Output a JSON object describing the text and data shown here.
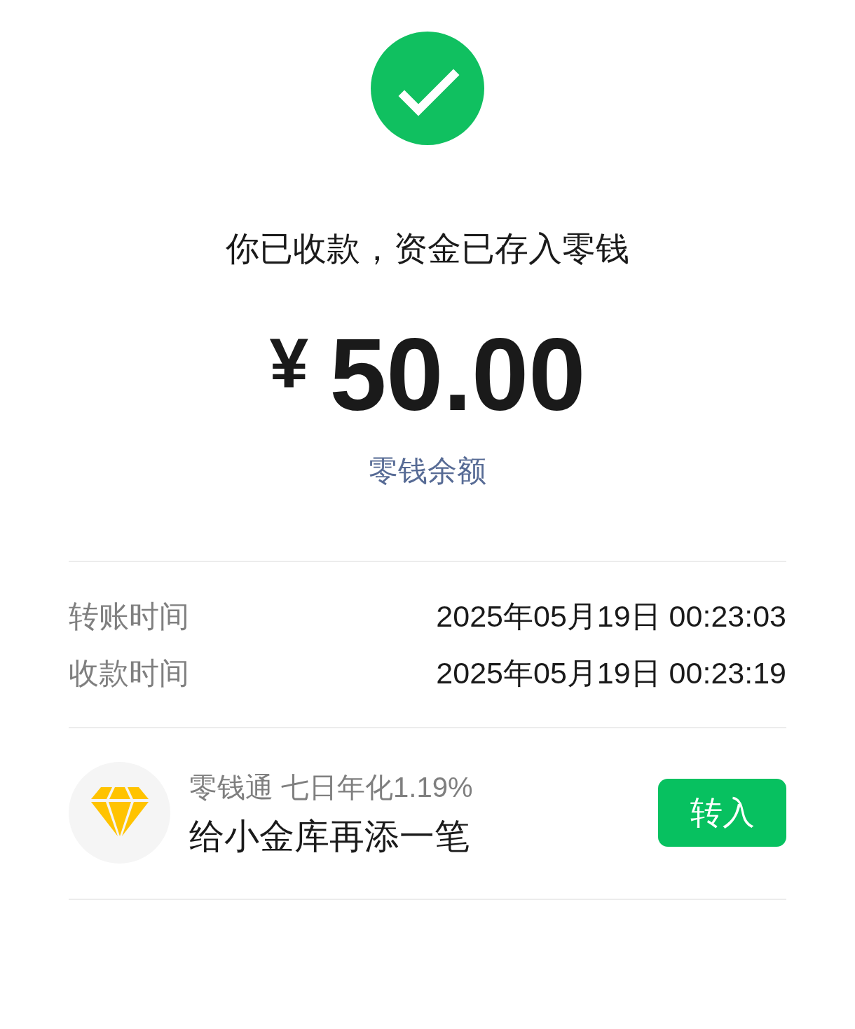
{
  "headline": "你已收款，资金已存入零钱",
  "amount": {
    "currency": "¥",
    "value": "50.00"
  },
  "balance_link": "零钱余额",
  "details": [
    {
      "label": "转账时间",
      "value": "2025年05月19日 00:23:03"
    },
    {
      "label": "收款时间",
      "value": "2025年05月19日 00:23:19"
    }
  ],
  "promo": {
    "title": "零钱通 七日年化1.19%",
    "subtitle": "给小金库再添一笔",
    "button": "转入"
  }
}
